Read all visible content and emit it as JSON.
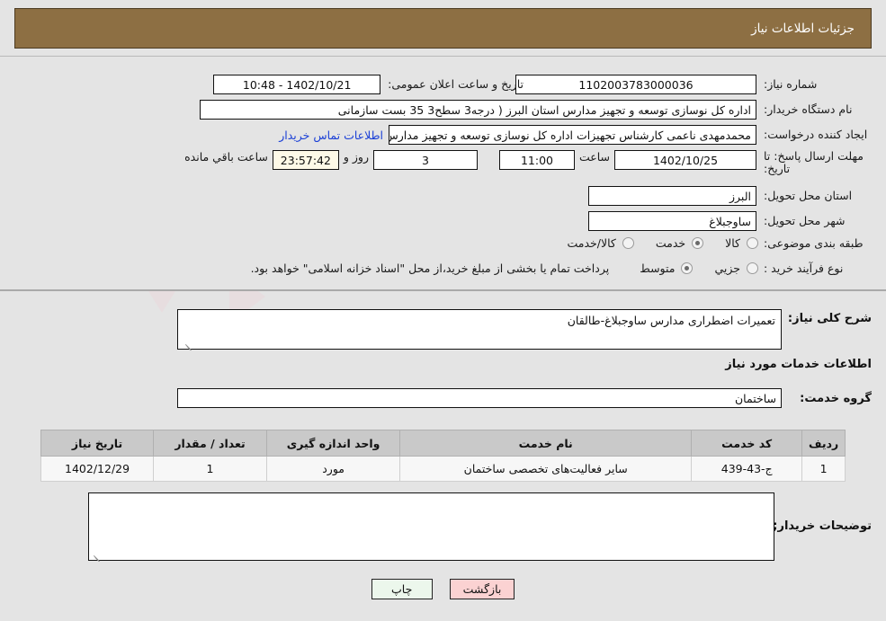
{
  "header": {
    "title": "جزئیات اطلاعات نیاز"
  },
  "fields": {
    "need_number_label": "شماره نیاز:",
    "need_number_value": "1102003783000036",
    "announce_label": "تاریخ و ساعت اعلان عمومی:",
    "announce_value": "1402/10/21 - 10:48",
    "buyer_org_label": "نام دستگاه خریدار:",
    "buyer_org_value": "اداره کل نوسازی   توسعه و تجهیز مدارس استان البرز ( درجه3  سطح3  35 بست سازمانی",
    "requester_label": "ایجاد کننده درخواست:",
    "requester_value": "محمدمهدی ناعمی کارشناس تجهیزات اداره کل نوسازی   توسعه و تجهیز مدارس",
    "buyer_contact_link": "اطلاعات تماس خریدار",
    "deadline_label": "مهلت ارسال پاسخ: تا تاریخ:",
    "deadline_date": "1402/10/25",
    "deadline_hour_label": "ساعت",
    "deadline_hour": "11:00",
    "days_value": "3",
    "days_label": "روز و",
    "countdown_value": "23:57:42",
    "countdown_label": "ساعت باقي مانده",
    "province_label": "استان محل تحویل:",
    "province_value": "البرز",
    "city_label": "شهر محل تحویل:",
    "city_value": "ساوجبلاغ",
    "category_label": "طبقه بندی موضوعی:",
    "process_label": "نوع فرآیند خرید :",
    "payment_note": "پرداخت تمام یا بخشی از مبلغ خرید،از محل \"اسناد خزانه اسلامی\" خواهد بود."
  },
  "category_options": [
    {
      "label": "کالا",
      "selected": false
    },
    {
      "label": "خدمت",
      "selected": true
    },
    {
      "label": "کالا/خدمت",
      "selected": false
    }
  ],
  "process_options": [
    {
      "label": "جزیي",
      "selected": false
    },
    {
      "label": "متوسط",
      "selected": true
    }
  ],
  "description": {
    "label": "شرح کلی نیاز:",
    "value": "تعمیرات اضطراری مدارس ساوجبلاغ-طالقان"
  },
  "services_section": {
    "heading": "اطلاعات خدمات مورد نیاز",
    "group_label": "گروه خدمت:",
    "group_value": "ساختمان"
  },
  "table": {
    "columns": [
      "ردیف",
      "کد خدمت",
      "نام خدمت",
      "واحد اندازه گیری",
      "تعداد / مقدار",
      "تاریخ نیاز"
    ],
    "rows": [
      {
        "row": "1",
        "code": "ج-43-439",
        "name": "سایر فعالیت‌های تخصصی ساختمان",
        "unit": "مورد",
        "qty": "1",
        "date": "1402/12/29"
      }
    ]
  },
  "buyer_notes": {
    "label": "توضیحات خریدار;",
    "value": ""
  },
  "footer": {
    "print_label": "چاپ",
    "back_label": "بازگشت"
  },
  "colors": {
    "header_brown": "#8d6f43",
    "link_blue": "#1a3fd6",
    "print_green": "#ecf7ec",
    "back_pink": "#fbd2d2",
    "countdown_cream": "#fdf9e7"
  }
}
